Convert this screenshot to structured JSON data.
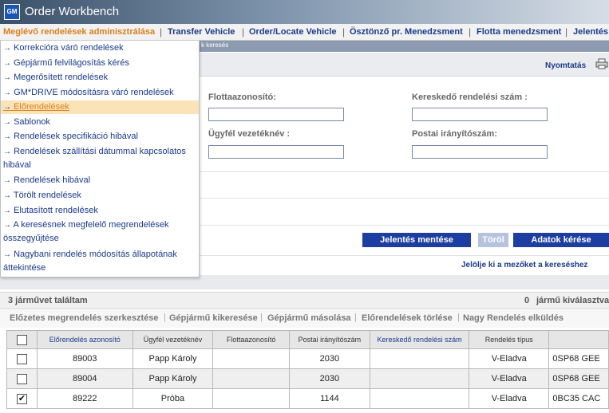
{
  "app": {
    "logo_text": "GM",
    "title_prefix": "Order",
    "title_suffix": "Workbench"
  },
  "nav": {
    "items": [
      {
        "label": "Meglévő rendelések adminisztrálása",
        "active": true
      },
      {
        "label": "Transfer Vehicle"
      },
      {
        "label": "Order/Locate Vehicle"
      },
      {
        "label": "Ösztönző pr. Menedzsment"
      },
      {
        "label": "Flotta menedzsment"
      },
      {
        "label": "Jelentés"
      }
    ]
  },
  "substrip_text": "k keresés",
  "dropdown": {
    "items": [
      {
        "label": "Korrekcióra váró rendelések"
      },
      {
        "label": "Gépjármű felvilágosítás kérés"
      },
      {
        "label": "Megerősített rendelések"
      },
      {
        "label": "GM*DRIVE módosításra váró rendelések"
      },
      {
        "label": "Előrendelések",
        "active": true
      },
      {
        "label": "Sablonok"
      },
      {
        "label": "Rendelések specifikáció hibával"
      },
      {
        "label": "Rendelések szállítási dátummal kapcsolatos hibával"
      },
      {
        "label": "Rendelések hibával"
      },
      {
        "label": "Törölt rendelések"
      },
      {
        "label": "Elutasított rendelések"
      },
      {
        "label": "A keresésnek megfelelő megrendelések összegyűjtése"
      },
      {
        "label": "Nagybani rendelés módosítás állapotának áttekintése"
      }
    ]
  },
  "print": {
    "label": "Nyomtatás",
    "icon": "printer-icon"
  },
  "form": {
    "fleet_id_label": "Flottaazonosító:",
    "fleet_id_value": "",
    "dealer_order_label": "Kereskedő rendelési szám :",
    "dealer_order_value": "",
    "customer_name_label": "Ügyfél vezetéknév :",
    "customer_name_value": "",
    "postal_code_label": "Postai irányítószám:",
    "postal_code_value": ""
  },
  "buttons": {
    "save_report": "Jelentés mentése",
    "clear": "Töröl",
    "request_data": "Adatok kérése"
  },
  "hint": "Jelölje ki a mezőket a kereséshez",
  "results": {
    "found_text": "3  járművet találtam",
    "selected_count": "0",
    "selected_text": "jármű kiválasztva"
  },
  "actions": [
    "Előzetes megrendelés szerkesztése",
    "Gépjármű kikeresése",
    "Gépjármű másolása",
    "Előrendelések törlése",
    "Nagy Rendelés elküldés"
  ],
  "table": {
    "headers": [
      "Előrendelés azonosító",
      "Ügyfél vezetéknév",
      "Flottaazonosító",
      "Postai irányítószám",
      "Kereskedő rendelési szám",
      "Rendelés típus",
      ""
    ],
    "rows": [
      {
        "checked": false,
        "cells": [
          "89003",
          "Papp Károly",
          "",
          "2030",
          "",
          "V-Eladva",
          "0SP68 GEE"
        ]
      },
      {
        "checked": false,
        "cells": [
          "89004",
          "Papp Károly",
          "",
          "2030",
          "",
          "V-Eladva",
          "0SP68 GEE"
        ]
      },
      {
        "checked": true,
        "cells": [
          "89222",
          "Próba",
          "",
          "1144",
          "",
          "V-Eladva",
          "0BC35 CAC"
        ]
      }
    ]
  },
  "colors": {
    "nav_active": "#d9801c",
    "link_blue": "#1a3a8a",
    "button_blue": "#1b3ea0"
  }
}
